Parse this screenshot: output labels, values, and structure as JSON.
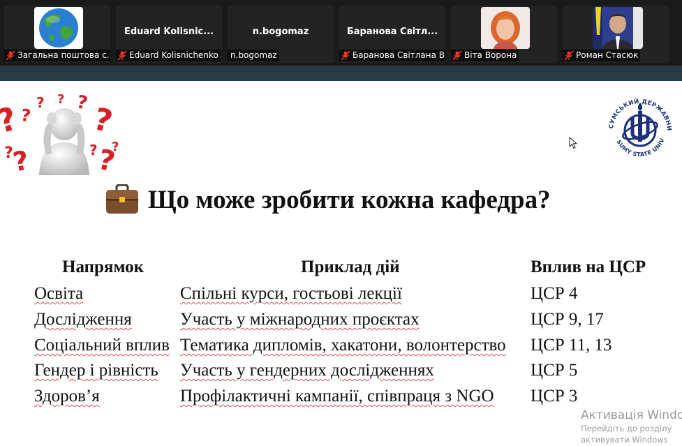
{
  "participants": [
    {
      "label": "Загальна поштова с...",
      "name": "",
      "thumb": "globe"
    },
    {
      "label": "Eduard Kolisnichenko",
      "name": "Eduard  Kolisnic...",
      "thumb": ""
    },
    {
      "label": "n.bogomaz",
      "name": "n.bogomaz",
      "thumb": ""
    },
    {
      "label": "Баранова Світлана В...",
      "name": "Баранова  Світл...",
      "thumb": ""
    },
    {
      "label": "Віта Ворона",
      "name": "",
      "thumb": "photo-woman"
    },
    {
      "label": "Роман Стасюк",
      "name": "",
      "thumb": "photo-man"
    }
  ],
  "slide": {
    "title": "Що може зробити кожна кафедра?",
    "table": {
      "headers": [
        "Напрямок",
        "Приклад дій",
        "Вплив на ЦСР"
      ],
      "rows": [
        [
          "Освіта",
          "Спільні курси, гостьові лекції",
          "ЦСР 4"
        ],
        [
          "Дослідження",
          "Участь у міжнародних проєктах",
          "ЦСР 9, 17"
        ],
        [
          "Соціальний вплив",
          "Тематика дипломів, хакатони, волонтерство",
          "ЦСР 11, 13"
        ],
        [
          "Гендер і рівність",
          "Участь у гендерних дослідженнях",
          "ЦСР 5"
        ],
        [
          "Здоров’я",
          "Профілактичні кампанії, співпраця з NGO",
          "ЦСР 3"
        ]
      ]
    },
    "logo_text": "СУМСЬКИЙ ДЕРЖАВНИЙ УНІВЕРСИТЕТ · SUMY STATE UNIVERSITY"
  },
  "watermark": {
    "title": "Активація Windows",
    "line1": "Перейдіть до розділу",
    "line2": "активувати Windows"
  },
  "colors": {
    "strip_bg": "#1a1a1a",
    "band": "#2a3a45",
    "muted_red": "#e0342c",
    "question_red": "#d81f26",
    "logo_blue": "#1b2f7a",
    "text": "#111111"
  },
  "icons": {
    "mute": "muted-microphone-icon",
    "title": "briefcase-icon",
    "cursor": "mouse-cursor-icon"
  }
}
